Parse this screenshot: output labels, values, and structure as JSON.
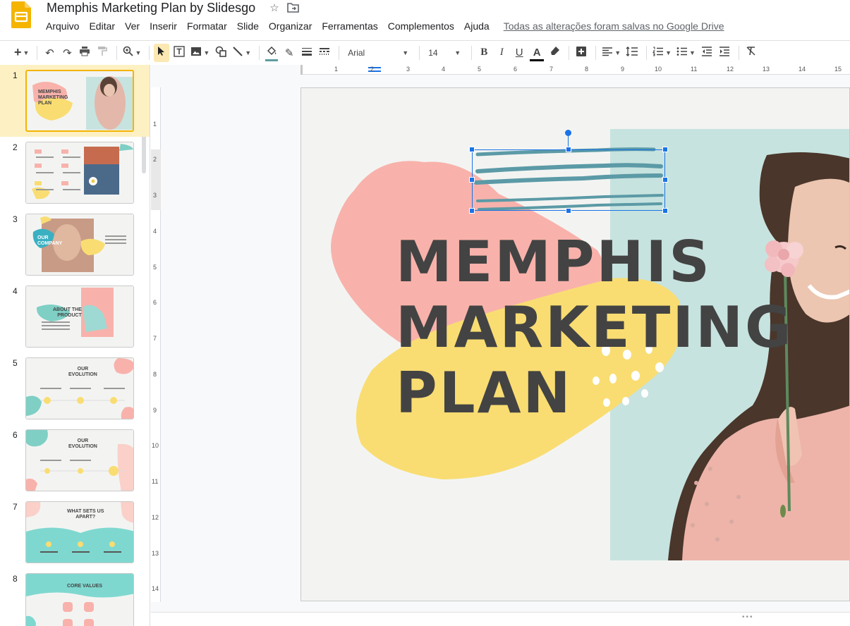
{
  "header": {
    "title": "Memphis Marketing Plan by Slidesgo",
    "star_icon": "star-icon",
    "move_icon": "folder-move-icon",
    "menu": [
      "Arquivo",
      "Editar",
      "Ver",
      "Inserir",
      "Formatar",
      "Slide",
      "Organizar",
      "Ferramentas",
      "Complementos",
      "Ajuda"
    ],
    "save_status": "Todas as alterações foram salvas no Google Drive"
  },
  "toolbar": {
    "font": "Arial",
    "font_size": "14",
    "bold": "B",
    "italic": "I",
    "underline": "U",
    "text_color": "A"
  },
  "filmstrip": {
    "slides": [
      {
        "num": "1",
        "title": "MEMPHIS\nMARKETING\nPLAN"
      },
      {
        "num": "2",
        "title": ""
      },
      {
        "num": "3",
        "title": "OUR\nCOMPANY"
      },
      {
        "num": "4",
        "title": "ABOUT THE\nPRODUCT"
      },
      {
        "num": "5",
        "title": "OUR\nEVOLUTION"
      },
      {
        "num": "6",
        "title": "OUR\nEVOLUTION"
      },
      {
        "num": "7",
        "title": "WHAT SETS US\nAPART?"
      },
      {
        "num": "8",
        "title": "CORE VALUES"
      }
    ]
  },
  "rulers": {
    "horizontal": [
      "1",
      "2",
      "3",
      "4",
      "5",
      "6",
      "7",
      "8",
      "9",
      "10",
      "11",
      "12",
      "13",
      "14",
      "15"
    ],
    "vertical": [
      "1",
      "2",
      "3",
      "4",
      "5",
      "6",
      "7",
      "8",
      "9",
      "10",
      "11",
      "12",
      "13",
      "14"
    ]
  },
  "slide": {
    "title": "MEMPHIS\nMARKETING\nPLAN"
  },
  "colors": {
    "pink": "#f8b2ab",
    "yellow": "#f9dd72",
    "mint": "#c7e3df",
    "teal_scribble": "#5b9aa6",
    "selection": "#1a73e8",
    "brand_yellow": "#f4b400"
  }
}
